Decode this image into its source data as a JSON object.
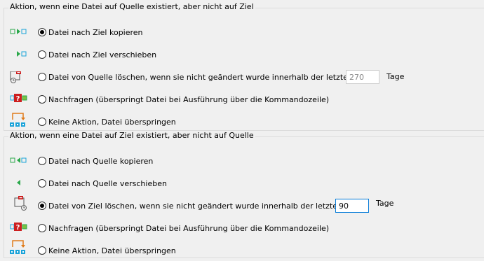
{
  "section_target_missing": {
    "title": "Aktion, wenn eine Datei auf Quelle existiert, aber nicht auf Ziel",
    "options": [
      {
        "label": "Datei nach Ziel kopieren",
        "icon": "copy-to-target-icon",
        "selected": true
      },
      {
        "label": "Datei nach Ziel verschieben",
        "icon": "move-to-target-icon",
        "selected": false
      },
      {
        "label": "Datei von Quelle löschen, wenn sie nicht geändert wurde innerhalb der letzten",
        "icon": "delete-source-icon",
        "selected": false
      },
      {
        "label": "Nachfragen (überspringt Datei bei Ausführung über die Kommandozeile)",
        "icon": "ask-icon",
        "selected": false
      },
      {
        "label": "Keine Aktion, Datei überspringen",
        "icon": "skip-icon",
        "selected": false
      }
    ],
    "days_value": "270",
    "days_unit": "Tage",
    "days_enabled": false
  },
  "section_source_missing": {
    "title": "Aktion, wenn eine Datei auf Ziel existiert, aber nicht auf Quelle",
    "options": [
      {
        "label": "Datei nach Quelle kopieren",
        "icon": "copy-to-source-icon",
        "selected": false
      },
      {
        "label": "Datei nach Quelle verschieben",
        "icon": "move-to-source-icon",
        "selected": false
      },
      {
        "label": "Datei von Ziel löschen, wenn sie nicht geändert wurde innerhalb der letzten",
        "icon": "delete-target-icon",
        "selected": true
      },
      {
        "label": "Nachfragen (überspringt Datei bei Ausführung über die Kommandozeile)",
        "icon": "ask-icon",
        "selected": false
      },
      {
        "label": "Keine Aktion, Datei überspringen",
        "icon": "skip-icon",
        "selected": false
      }
    ],
    "days_value": "90",
    "days_unit": "Tage",
    "days_enabled": true
  },
  "colors": {
    "green": "#2aa84a",
    "cyan": "#1aa3d9",
    "red": "#cc1f1f",
    "orange": "#e07b1a",
    "focus": "#0078d7"
  }
}
